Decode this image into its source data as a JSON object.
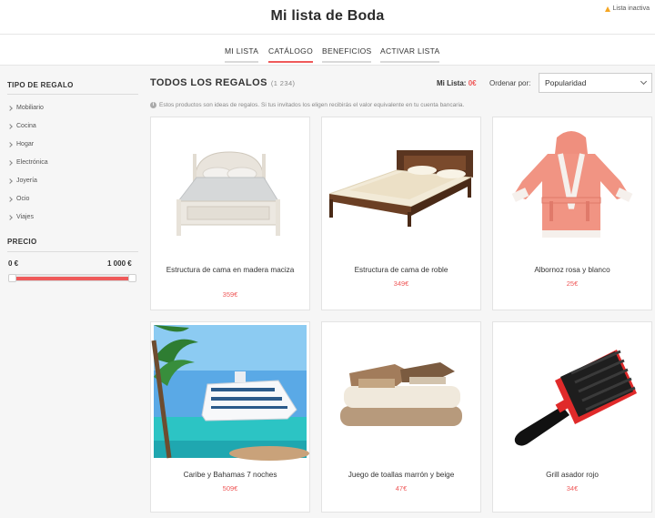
{
  "header": {
    "title": "Mi lista de Boda",
    "status_label": "Lista inactiva",
    "status_icon": "warning-icon"
  },
  "nav": {
    "tabs": [
      "MI LISTA",
      "CATÁLOGO",
      "BENEFICIOS",
      "ACTIVAR LISTA"
    ],
    "active": "CATÁLOGO"
  },
  "sidebar": {
    "gift_type_title": "TIPO DE REGALO",
    "categories": [
      "Mobiliario",
      "Cocina",
      "Hogar",
      "Electrónica",
      "Joyería",
      "Ocio",
      "Viajes"
    ],
    "price_title": "PRECIO",
    "price_min": "0 €",
    "price_max": "1 000 €"
  },
  "main": {
    "title": "TODOS LOS REGALOS",
    "count": "(1 234)",
    "mi_lista_label": "Mi Lista:",
    "mi_lista_value": "0€",
    "sort_label": "Ordenar por:",
    "sort_value": "Popularidad",
    "info_text": "Estos productos son ideas de regalos. Si tus invitados los eligen recibirás el valor equivalente en tu cuenta bancaria."
  },
  "products": [
    {
      "name": "Estructura de cama en madera maciza",
      "price": "359€"
    },
    {
      "name": "Estructura de cama de roble",
      "price": "349€"
    },
    {
      "name": "Albornoz rosa y blanco",
      "price": "25€"
    },
    {
      "name": "Caribe y Bahamas 7 noches",
      "price": "509€"
    },
    {
      "name": "Juego de toallas marrón y beige",
      "price": "47€"
    },
    {
      "name": "Grill asador rojo",
      "price": "34€"
    }
  ],
  "colors": {
    "accent": "#ef5a5a",
    "background": "#f6f6f6"
  }
}
